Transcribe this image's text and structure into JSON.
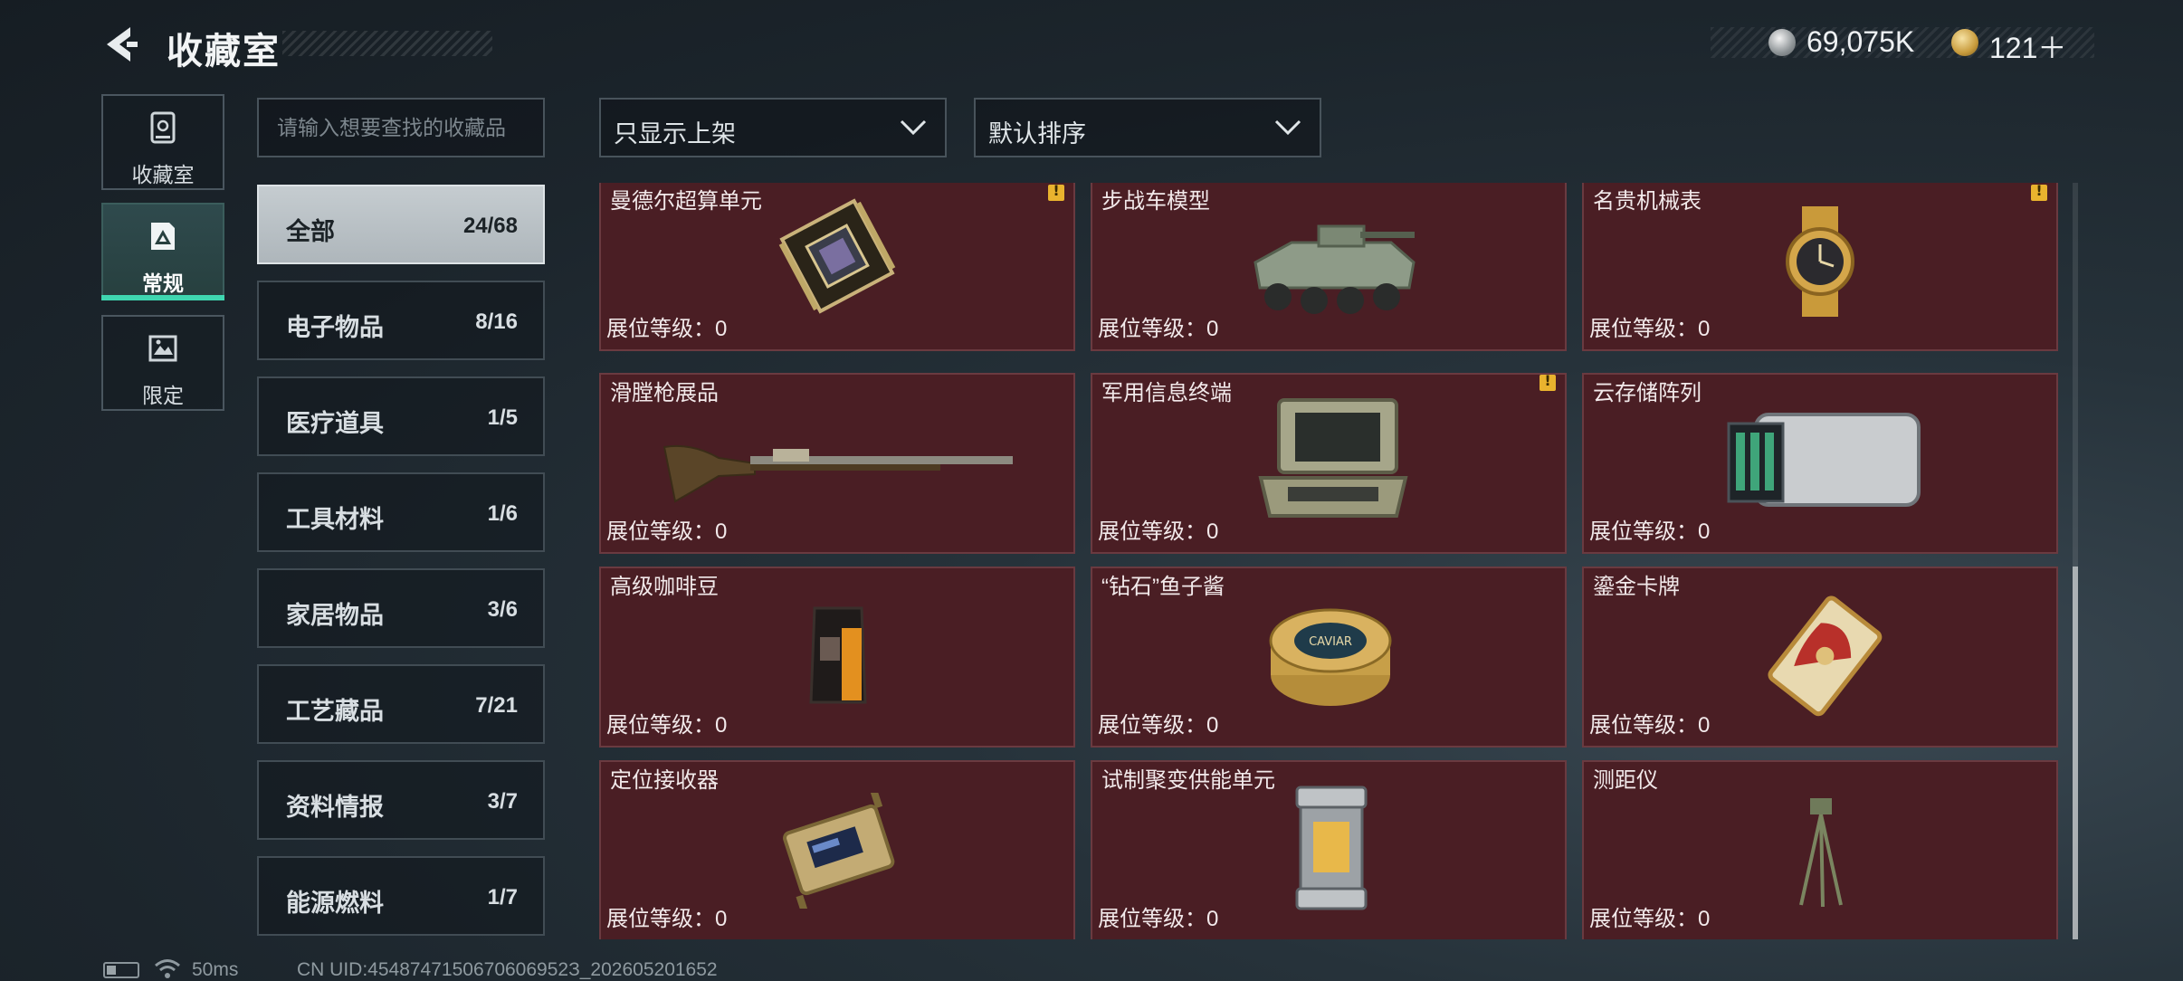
{
  "header": {
    "title": "收藏室",
    "currency_silver": "69,075K",
    "currency_gold": "121＋"
  },
  "nav": {
    "collection_label": "收藏室",
    "regular_label": "常规",
    "limited_label": "限定"
  },
  "search": {
    "placeholder": "请输入想要查找的收藏品"
  },
  "filters": {
    "display_filter": "只显示上架",
    "sort": "默认排序"
  },
  "categories": [
    {
      "name": "全部",
      "count": "24/68",
      "active": true
    },
    {
      "name": "电子物品",
      "count": "8/16"
    },
    {
      "name": "医疗道具",
      "count": "1/5"
    },
    {
      "name": "工具材料",
      "count": "1/6"
    },
    {
      "name": "家居物品",
      "count": "3/6"
    },
    {
      "name": "工艺藏品",
      "count": "7/21"
    },
    {
      "name": "资料情报",
      "count": "3/7"
    },
    {
      "name": "能源燃料",
      "count": "1/7"
    }
  ],
  "items": [
    {
      "name": "曼德尔超算单元",
      "level": "展位等级：0",
      "icon": "circuit-board-icon",
      "alert": true
    },
    {
      "name": "步战车模型",
      "level": "展位等级：0",
      "icon": "armored-vehicle-icon"
    },
    {
      "name": "名贵机械表",
      "level": "展位等级：0",
      "icon": "wristwatch-icon",
      "alert": true
    },
    {
      "name": "滑膛枪展品",
      "level": "展位等级：0",
      "icon": "musket-icon"
    },
    {
      "name": "军用信息终端",
      "level": "展位等级：0",
      "icon": "rugged-terminal-icon",
      "alert": true
    },
    {
      "name": "云存储阵列",
      "level": "展位等级：0",
      "icon": "storage-array-icon"
    },
    {
      "name": "高级咖啡豆",
      "level": "展位等级：0",
      "icon": "coffee-bag-icon"
    },
    {
      "name": "“钻石”鱼子酱",
      "level": "展位等级：0",
      "icon": "caviar-tin-icon",
      "tin_text": "CAVIAR"
    },
    {
      "name": "鎏金卡牌",
      "level": "展位等级：0",
      "icon": "gilded-card-icon"
    },
    {
      "name": "定位接收器",
      "level": "展位等级：0",
      "icon": "gps-receiver-icon"
    },
    {
      "name": "试制聚变供能单元",
      "level": "展位等级：0",
      "icon": "fusion-cell-icon"
    },
    {
      "name": "测距仪",
      "level": "展位等级：0",
      "icon": "rangefinder-tripod-icon"
    }
  ],
  "status": {
    "ping": "50ms",
    "uid": "CN UID:4548747150670606952З_202605201652"
  }
}
